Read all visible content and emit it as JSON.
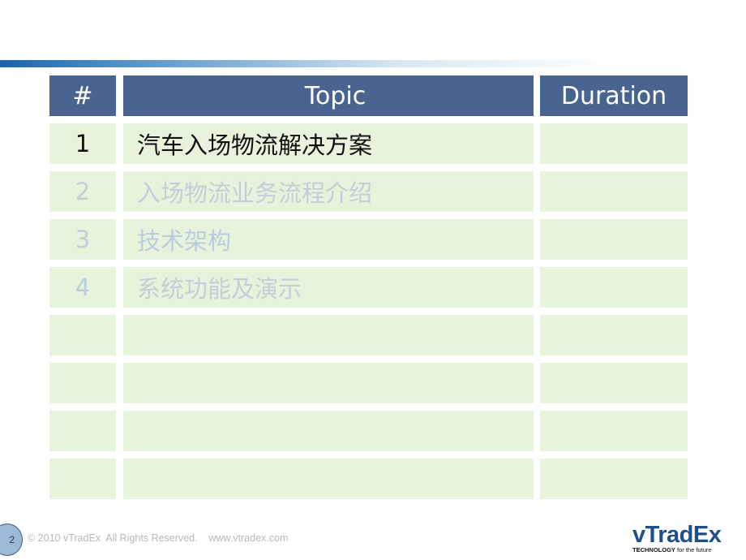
{
  "slide": {
    "page_number": "2",
    "footer_text": "© 2010 vTradEx  All Rights Reserved.    www.vtradex.com",
    "logo": {
      "name": "vTradEx",
      "tagline_bold": "TECHNOLOGY",
      "tagline": " for the future"
    }
  },
  "table": {
    "headers": {
      "number": "#",
      "topic": "Topic",
      "duration": "Duration"
    },
    "rows": [
      {
        "number": "1",
        "topic": "汽车入场物流解决方案",
        "duration": "",
        "state": "active"
      },
      {
        "number": "2",
        "topic": "入场物流业务流程介绍",
        "duration": "",
        "state": "dimmed"
      },
      {
        "number": "3",
        "topic": "技术架构",
        "duration": "",
        "state": "dimmed"
      },
      {
        "number": "4",
        "topic": "系统功能及演示",
        "duration": "",
        "state": "dimmed"
      },
      {
        "number": "",
        "topic": "",
        "duration": "",
        "state": "empty"
      },
      {
        "number": "",
        "topic": "",
        "duration": "",
        "state": "empty"
      },
      {
        "number": "",
        "topic": "",
        "duration": "",
        "state": "empty"
      },
      {
        "number": "",
        "topic": "",
        "duration": "",
        "state": "empty"
      }
    ]
  },
  "colors": {
    "header_bg": "#4a6491",
    "row_bg": "#e7f3da",
    "active_text": "#111111",
    "dimmed_text": "#c5cdd8",
    "accent_bar": "#1a63ad",
    "logo": "#1f4e8c"
  }
}
